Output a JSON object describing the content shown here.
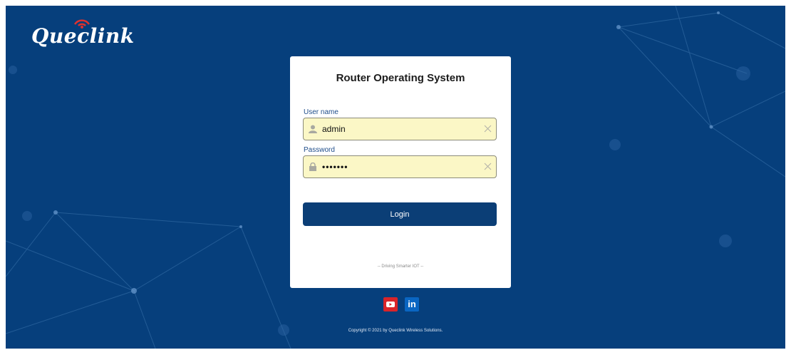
{
  "brand": {
    "logo_text": "Queclink"
  },
  "login": {
    "title": "Router Operating System",
    "username_label": "User name",
    "username_value": "admin",
    "password_label": "Password",
    "password_value": "•••••••",
    "login_label": "Login",
    "tagline": "-- Driving Smarter IOT --"
  },
  "social": {
    "linkedin_text": "in"
  },
  "footer": {
    "copyright": "Copyright © 2021 by Queclink Wireless Solutions."
  },
  "icons": {
    "username": "user-icon",
    "password": "lock-icon",
    "clear": "close-icon",
    "youtube": "youtube-icon",
    "linkedin": "linkedin-icon"
  },
  "colors": {
    "background": "#063f7c",
    "input_fill": "#fbf7c6",
    "button": "#0b3e76",
    "youtube": "#d9242a",
    "linkedin": "#0a66c2"
  }
}
